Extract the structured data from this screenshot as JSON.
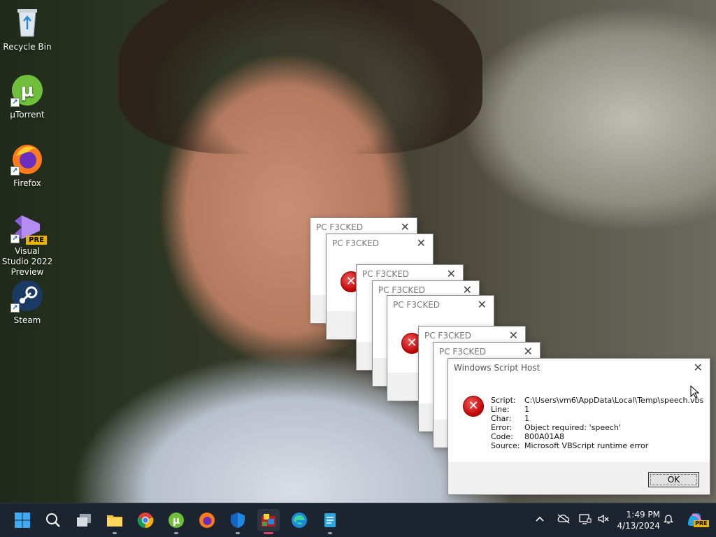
{
  "desktop": {
    "icons": [
      {
        "label": "Recycle Bin"
      },
      {
        "label": "µTorrent"
      },
      {
        "label": "Firefox"
      },
      {
        "label": "Visual Studio 2022 Preview",
        "badge": "PRE"
      },
      {
        "label": "Steam"
      }
    ]
  },
  "popups": {
    "title": "PC F3CKED",
    "close": "✕",
    "count": 7
  },
  "dialog": {
    "title": "Windows Script Host",
    "close": "✕",
    "fields": [
      {
        "key": "Script:",
        "value": "C:\\Users\\vm6\\AppData\\Local\\Temp\\speech.vbs"
      },
      {
        "key": "Line:",
        "value": "1"
      },
      {
        "key": "Char:",
        "value": "1"
      },
      {
        "key": "Error:",
        "value": "Object required: 'speech'"
      },
      {
        "key": "Code:",
        "value": "800A01A8"
      },
      {
        "key": "Source:",
        "value": "Microsoft VBScript runtime error"
      }
    ],
    "ok_label": "OK"
  },
  "taskbar": {
    "pinned": [
      "start-icon",
      "search-icon",
      "task-view-icon",
      "file-explorer-icon",
      "chrome-icon",
      "utorrent-icon",
      "firefox-icon",
      "windows-security-icon",
      "script-app-icon",
      "edge-icon",
      "notepad-icon"
    ],
    "time": "1:49 PM",
    "date": "4/13/2024",
    "copilot_badge": "PRE"
  },
  "colors": {
    "taskbar_bg": "#1c2430",
    "error_red": "#c00000",
    "active_indicator": "#d9435d"
  }
}
